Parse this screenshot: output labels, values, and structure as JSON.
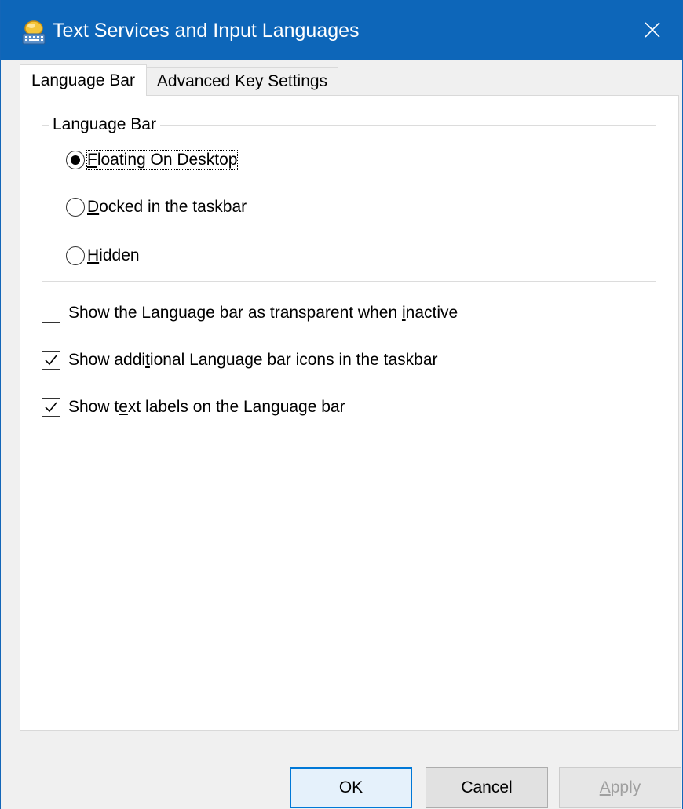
{
  "window": {
    "title": "Text Services and Input Languages",
    "accent_color": "#0d66b9"
  },
  "tabs": [
    {
      "label": "Language Bar",
      "active": true
    },
    {
      "label": "Advanced Key Settings",
      "active": false
    }
  ],
  "group": {
    "legend": "Language Bar",
    "radios": [
      {
        "pre": "",
        "key": "F",
        "post": "loating On Desktop",
        "selected": true
      },
      {
        "pre": "",
        "key": "D",
        "post": "ocked in the taskbar",
        "selected": false
      },
      {
        "pre": "",
        "key": "H",
        "post": "idden",
        "selected": false
      }
    ]
  },
  "checkboxes": [
    {
      "pre": "Show the Language bar as transparent when ",
      "key": "i",
      "post": "nactive",
      "checked": false
    },
    {
      "pre": "Show addi",
      "key": "t",
      "post": "ional Language bar icons in the taskbar",
      "checked": true
    },
    {
      "pre": "Show t",
      "key": "e",
      "post": "xt labels on the Language bar",
      "checked": true
    }
  ],
  "buttons": {
    "ok": "OK",
    "cancel": "Cancel",
    "apply_key": "A",
    "apply_rest": "pply"
  },
  "icons": {
    "app": "keyboard-icon",
    "close": "close-icon"
  }
}
